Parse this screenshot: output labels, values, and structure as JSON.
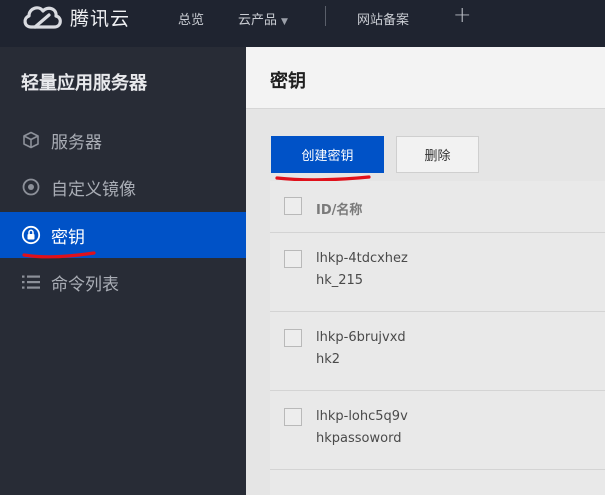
{
  "topbar": {
    "logo_text": "腾讯云",
    "nav": [
      {
        "label": "总览"
      },
      {
        "label": "云产品"
      },
      {
        "label": "网站备案"
      }
    ],
    "plus_label": "+"
  },
  "sidebar": {
    "title": "轻量应用服务器",
    "items": [
      {
        "label": "服务器",
        "icon": "cube-icon",
        "active": false
      },
      {
        "label": "自定义镜像",
        "icon": "disc-icon",
        "active": false
      },
      {
        "label": "密钥",
        "icon": "key-lock-icon",
        "active": true
      },
      {
        "label": "命令列表",
        "icon": "list-icon",
        "active": false
      }
    ]
  },
  "main": {
    "title": "密钥",
    "buttons": {
      "create": "创建密钥",
      "delete": "删除"
    },
    "table": {
      "header": "ID/名称",
      "rows": [
        {
          "id": "lhkp-4tdcxhez",
          "name": "hk_215"
        },
        {
          "id": "lhkp-6brujvxd",
          "name": "hk2"
        },
        {
          "id": "lhkp-lohc5q9v",
          "name": "hkpassoword"
        }
      ]
    }
  },
  "colors": {
    "topbar_bg": "#1f2430",
    "sidebar_bg": "#282c36",
    "accent": "#0052c7",
    "annotation": "#e0101a"
  }
}
